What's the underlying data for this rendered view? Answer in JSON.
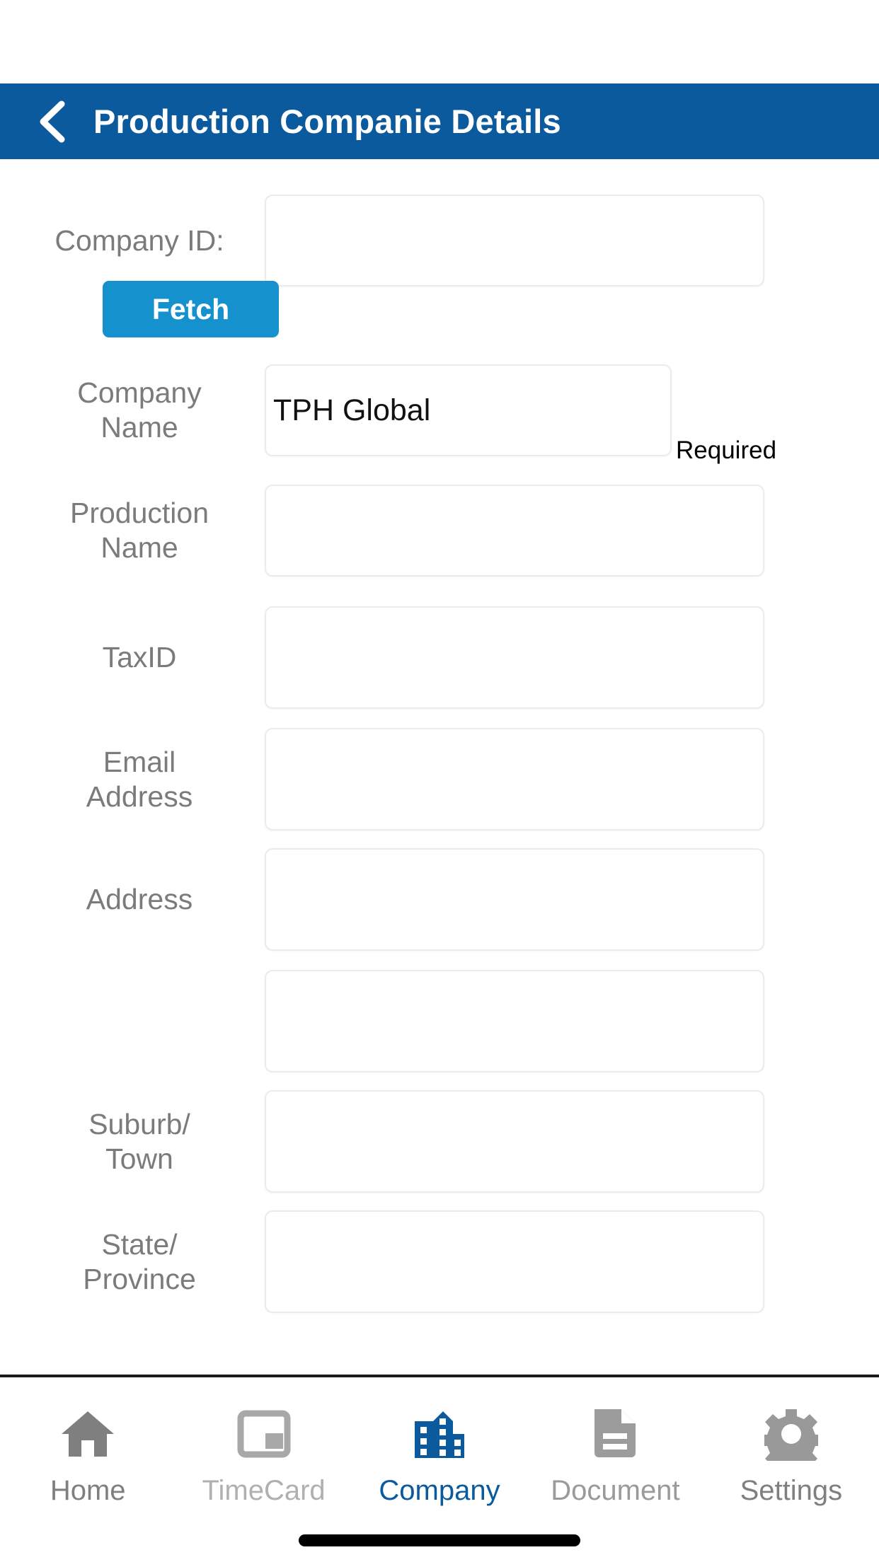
{
  "header": {
    "title": "Production Companie Details",
    "back_icon": "chevron-left-icon",
    "background_color": "#0c5a9e",
    "text_color": "#ffffff"
  },
  "form": {
    "fetch_label": "Fetch",
    "fetch_color": "#1592cd",
    "required_note": "Required",
    "fields": [
      {
        "label": "Company ID:",
        "value": "",
        "placeholder": ""
      },
      {
        "label": "Company Name",
        "value": "TPH Global",
        "placeholder": ""
      },
      {
        "label": "Production Name",
        "value": "",
        "placeholder": ""
      },
      {
        "label": "TaxID",
        "value": "",
        "placeholder": ""
      },
      {
        "label": "Email Address",
        "value": "",
        "placeholder": ""
      },
      {
        "label": "Address",
        "value": "",
        "placeholder": ""
      },
      {
        "label": "",
        "value": "",
        "placeholder": ""
      },
      {
        "label": "Suburb/ Town",
        "value": "",
        "placeholder": ""
      },
      {
        "label": "State/ Province",
        "value": "",
        "placeholder": ""
      }
    ],
    "labels": {
      "company_id": "Company ID:",
      "company_name_l1": "Company",
      "company_name_l2": "Name",
      "production_name_l1": "Production",
      "production_name_l2": "Name",
      "taxid": "TaxID",
      "email_l1": "Email",
      "email_l2": "Address",
      "address": "Address",
      "suburb_l1": "Suburb/",
      "suburb_l2": "Town",
      "state_l1": "State/",
      "state_l2": "Province"
    },
    "values": {
      "company_id": "",
      "company_name": "TPH Global",
      "production_name": "",
      "taxid": "",
      "email": "",
      "address_line1": "",
      "address_line2": "",
      "suburb": "",
      "state": ""
    }
  },
  "tabbar": {
    "active_color": "#0c5a9e",
    "items": [
      {
        "label": "Home",
        "icon": "home-icon",
        "active": false
      },
      {
        "label": "TimeCard",
        "icon": "timecard-icon",
        "active": false
      },
      {
        "label": "Company",
        "icon": "building-icon",
        "active": true
      },
      {
        "label": "Document",
        "icon": "document-icon",
        "active": false
      },
      {
        "label": "Settings",
        "icon": "gear-icon",
        "active": false
      }
    ]
  }
}
